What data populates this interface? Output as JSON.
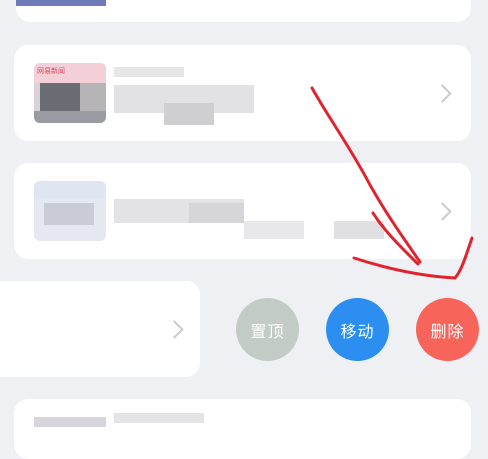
{
  "swipe_actions": {
    "pin_label": "置顶",
    "move_label": "移动",
    "delete_label": "删除"
  },
  "first_card_thumb_text": "网易新闻",
  "colors": {
    "background": "#eef0f4",
    "card": "#ffffff",
    "pin": "#c3cbc7",
    "move": "#2b8ef0",
    "delete": "#f7645a",
    "annotation": "#e0242f"
  }
}
